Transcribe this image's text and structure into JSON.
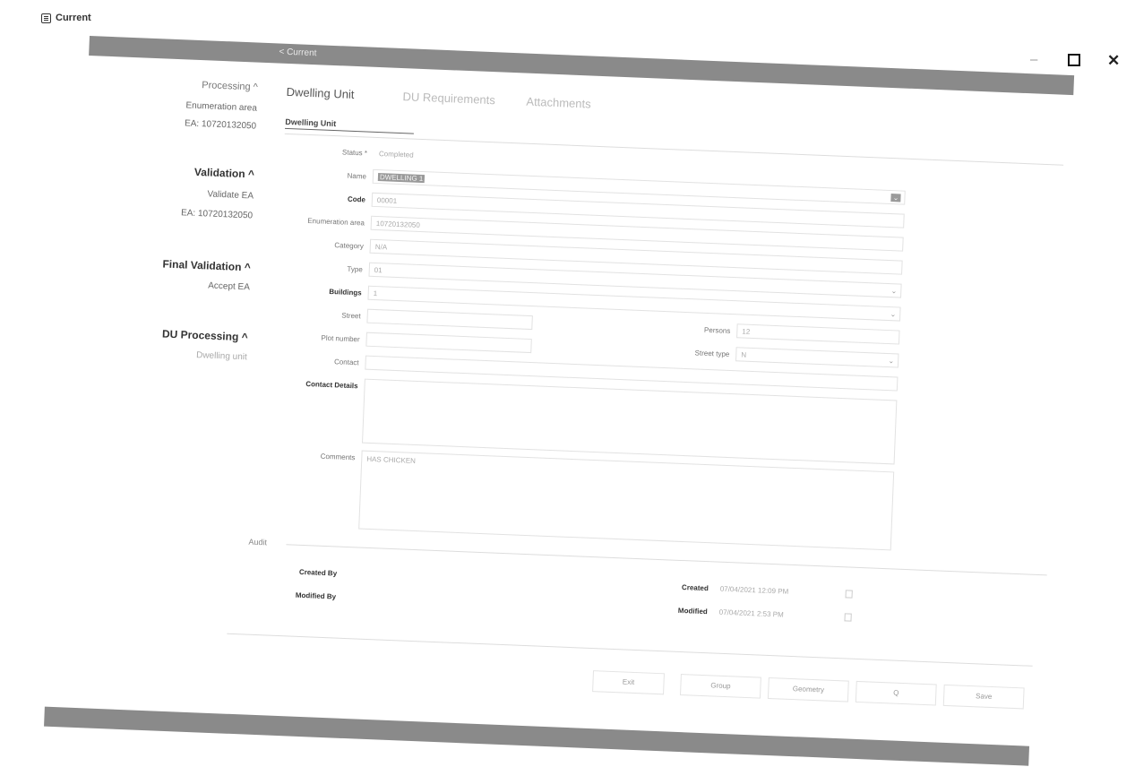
{
  "app": {
    "title": "Current"
  },
  "header": {
    "back_label": "< Current"
  },
  "sidebar": {
    "processing": {
      "title": "Processing ^",
      "items": [
        "Enumeration area",
        "EA: 10720132050"
      ]
    },
    "validation": {
      "title": "Validation ^",
      "items": [
        "Validate EA",
        "EA: 10720132050"
      ]
    },
    "final_validation": {
      "title": "Final Validation ^",
      "items": [
        "Accept EA"
      ]
    },
    "du_processing": {
      "title": "DU Processing ^",
      "items": [
        "Dwelling unit"
      ]
    }
  },
  "tabs": [
    "Dwelling Unit",
    "DU Requirements",
    "Attachments"
  ],
  "section_title": "Dwelling Unit",
  "form": {
    "status": {
      "label": "Status *",
      "value": "Completed"
    },
    "name": {
      "label": "Name",
      "value": "DWELLING 1"
    },
    "code": {
      "label": "Code",
      "value": "00001"
    },
    "enumeration_area": {
      "label": "Enumeration area",
      "value": "10720132050"
    },
    "category": {
      "label": "Category",
      "value": "N/A"
    },
    "type": {
      "label": "Type",
      "value": "01"
    },
    "buildings": {
      "label": "Buildings",
      "value": "1"
    },
    "street": {
      "label": "Street",
      "value": ""
    },
    "persons": {
      "label": "Persons",
      "value": "12"
    },
    "street_type": {
      "label": "Street type",
      "value": "N"
    },
    "plot_number": {
      "label": "Plot number",
      "value": ""
    },
    "contact": {
      "label": "Contact",
      "value": ""
    },
    "contact_details": {
      "label": "Contact Details",
      "value": ""
    },
    "comments": {
      "label": "Comments",
      "value": "HAS CHICKEN"
    }
  },
  "audit": {
    "title": "Audit",
    "created_by_label": "Created By",
    "created_by_value": "",
    "modified_by_label": "Modified By",
    "modified_by_value": "",
    "created_label": "Created",
    "created_value": "07/04/2021 12:09 PM",
    "modified_label": "Modified",
    "modified_value": "07/04/2021 2:53 PM"
  },
  "buttons": {
    "exit": "Exit",
    "group": "Group",
    "geometry": "Geometry",
    "search": "Q",
    "save": "Save"
  }
}
